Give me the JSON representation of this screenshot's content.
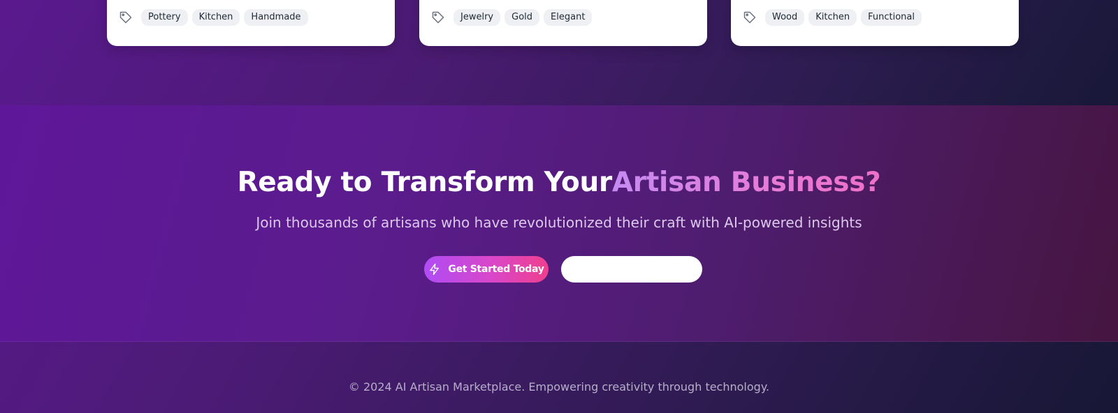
{
  "cards": [
    {
      "tags": [
        "Pottery",
        "Kitchen",
        "Handmade"
      ]
    },
    {
      "tags": [
        "Jewelry",
        "Gold",
        "Elegant"
      ]
    },
    {
      "tags": [
        "Wood",
        "Kitchen",
        "Functional"
      ]
    }
  ],
  "cta": {
    "title_plain": "Ready to Transform Your",
    "title_highlight": "Artisan Business?",
    "subtitle": "Join thousands of artisans who have revolutionized their craft with AI-powered insights",
    "primary_button": {
      "label": "Get Started Today",
      "icon": "lightning-icon"
    },
    "secondary_button": {
      "label": ""
    }
  },
  "footer": {
    "copyright": "© 2024 AI Artisan Marketplace. Empowering creativity through technology."
  },
  "colors": {
    "accent_gradient_start": "#b04cf5",
    "accent_gradient_end": "#ef3f8e",
    "highlight_text_start": "#c58bf2",
    "highlight_text_end": "#ee6fc8"
  }
}
